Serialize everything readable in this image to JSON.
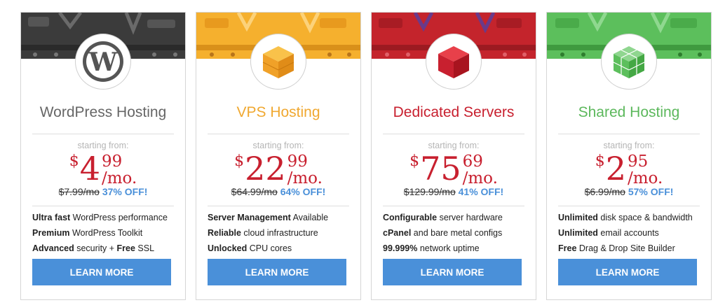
{
  "plans": [
    {
      "title": "WordPress Hosting",
      "starting_label": "starting from:",
      "currency": "$",
      "price_whole": "4",
      "price_cents": "99",
      "period": "/mo.",
      "old_price": "$7.99/mo",
      "discount": "37% OFF!",
      "features": [
        {
          "bold": "Ultra fast",
          "rest": " WordPress performance"
        },
        {
          "bold": "Premium",
          "rest": " WordPress Toolkit"
        },
        {
          "bold": "Advanced",
          "rest": " security + ",
          "bold2": "Free",
          "rest2": " SSL"
        }
      ],
      "button": "LEARN MORE",
      "icon": "wordpress-logo",
      "accent_color": "#666666",
      "banner_color": "#3b3b3b"
    },
    {
      "title": "VPS Hosting",
      "starting_label": "starting from:",
      "currency": "$",
      "price_whole": "22",
      "price_cents": "99",
      "period": "/mo.",
      "old_price": "$64.99/mo",
      "discount": "64% OFF!",
      "features": [
        {
          "bold": "Server Management",
          "rest": " Available"
        },
        {
          "bold": "Reliable",
          "rest": " cloud infrastructure"
        },
        {
          "bold": "Unlocked",
          "rest": " CPU cores"
        }
      ],
      "button": "LEARN MORE",
      "icon": "single-cube",
      "accent_color": "#f0a830",
      "banner_color": "#f5b02e"
    },
    {
      "title": "Dedicated Servers",
      "starting_label": "starting from:",
      "currency": "$",
      "price_whole": "75",
      "price_cents": "69",
      "period": "/mo.",
      "old_price": "$129.99/mo",
      "discount": "41% OFF!",
      "features": [
        {
          "bold": "Configurable",
          "rest": " server hardware"
        },
        {
          "bold": "cPanel",
          "rest": " and bare metal configs"
        },
        {
          "bold": "99.999%",
          "rest": " network uptime"
        }
      ],
      "button": "LEARN MORE",
      "icon": "red-cube",
      "accent_color": "#c8202f",
      "banner_color": "#c4242c"
    },
    {
      "title": "Shared Hosting",
      "starting_label": "starting from:",
      "currency": "$",
      "price_whole": "2",
      "price_cents": "95",
      "period": "/mo.",
      "old_price": "$6.99/mo",
      "discount": "57% OFF!",
      "features": [
        {
          "bold": "Unlimited",
          "rest": " disk space & bandwidth"
        },
        {
          "bold": "Unlimited",
          "rest": " email accounts"
        },
        {
          "bold": "Free",
          "rest": " Drag & Drop Site Builder"
        }
      ],
      "button": "LEARN MORE",
      "icon": "multi-cube",
      "accent_color": "#5cb85c",
      "banner_color": "#5cbf5c"
    }
  ],
  "price_color": "#c8202f",
  "button_color": "#4a90d9"
}
